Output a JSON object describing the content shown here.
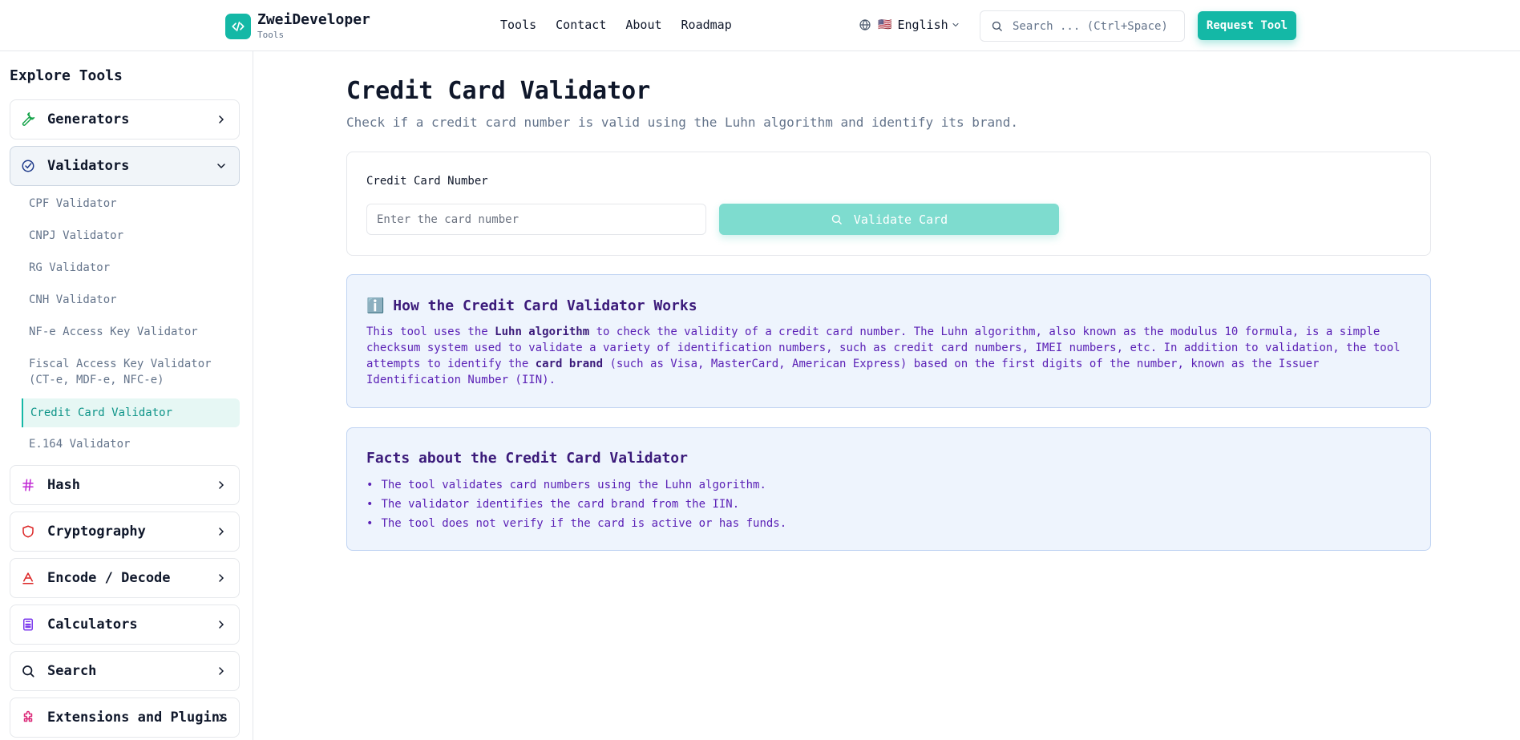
{
  "header": {
    "brand_name": "ZweiDeveloper",
    "brand_sub": "Tools",
    "nav": [
      "Tools",
      "Contact",
      "About",
      "Roadmap"
    ],
    "language_flag": "🇺🇸",
    "language": "English",
    "search_placeholder": "Search ... (Ctrl+Space)",
    "request_button": "Request Tool",
    "accent_color": "#14b8a6"
  },
  "sidebar": {
    "title": "Explore Tools",
    "categories": [
      {
        "label": "Generators",
        "icon": "wrench-icon",
        "open": false
      },
      {
        "label": "Validators",
        "icon": "check-circle-icon",
        "open": true
      },
      {
        "label": "Hash",
        "icon": "hash-icon",
        "open": false
      },
      {
        "label": "Cryptography",
        "icon": "shield-icon",
        "open": false
      },
      {
        "label": "Encode / Decode",
        "icon": "encode-icon",
        "open": false
      },
      {
        "label": "Calculators",
        "icon": "calculator-icon",
        "open": false
      },
      {
        "label": "Search",
        "icon": "search-icon",
        "open": false
      },
      {
        "label": "Extensions and Plugins",
        "icon": "puzzle-icon",
        "open": false
      }
    ],
    "validators": [
      {
        "label": "CPF Validator"
      },
      {
        "label": "CNPJ Validator"
      },
      {
        "label": "RG Validator"
      },
      {
        "label": "CNH Validator"
      },
      {
        "label": "NF-e Access Key Validator"
      },
      {
        "label": "Fiscal Access Key Validator",
        "label2": "(CT-e, MDF-e, NFC-e)"
      },
      {
        "label": "Credit Card Validator",
        "active": true
      },
      {
        "label": "E.164 Validator"
      }
    ]
  },
  "main": {
    "title": "Credit Card Validator",
    "description": "Check if a credit card number is valid using the Luhn algorithm and identify its brand.",
    "field_label": "Credit Card Number",
    "input_placeholder": "Enter the card number",
    "input_value": "",
    "validate_button": "Validate Card",
    "how_title": "How the Credit Card Validator Works",
    "how_icon": "ℹ️",
    "how_text": {
      "p1": "This tool uses the ",
      "b1": "Luhn algorithm",
      "p2": " to check the validity of a credit card number. The Luhn algorithm, also known as the modulus 10 formula, is a simple checksum system used to validate a variety of identification numbers, such as credit card numbers, IMEI numbers, etc. In addition to validation, the tool attempts to identify the ",
      "b2": "card brand",
      "p3": " (such as Visa, MasterCard, American Express) based on the first digits of the number, known as the Issuer Identification Number (IIN)."
    },
    "facts_title": "Facts about the Credit Card Validator",
    "facts": [
      "The tool validates card numbers using the Luhn algorithm.",
      "The validator identifies the card brand from the IIN.",
      "The tool does not verify if the card is active or has funds."
    ]
  }
}
